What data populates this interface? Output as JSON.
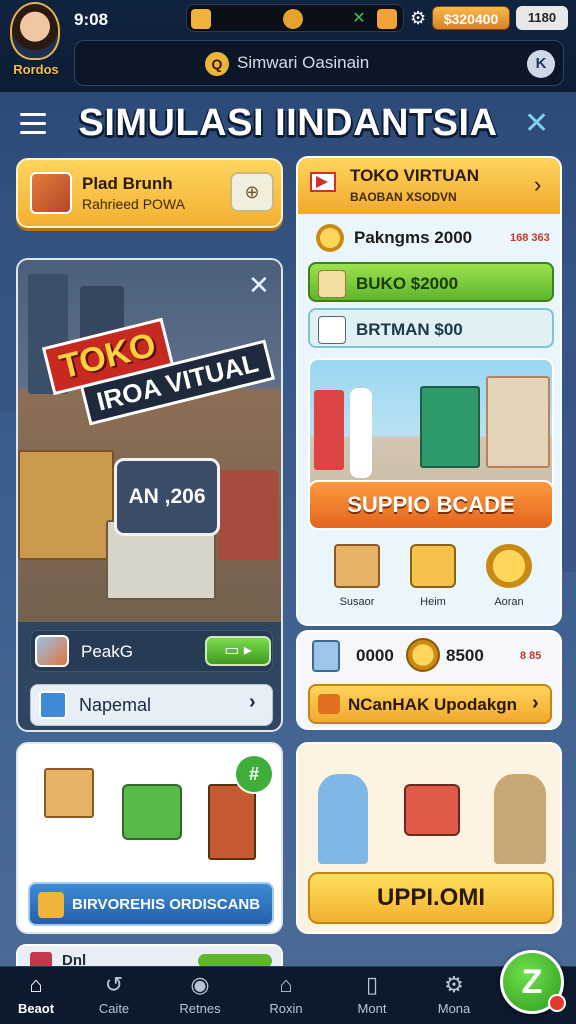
{
  "status": {
    "player_name": "Rordos",
    "time": "9:08",
    "money": "$320400",
    "level": "1180"
  },
  "search": {
    "placeholder": "Simwari Oasinain"
  },
  "header": {
    "title": "SIMULASI IINDANTSIA"
  },
  "plaid_card": {
    "line1": "Plad Brunh",
    "line2": "Rahrieed POWA"
  },
  "toko_card": {
    "title": "TOKO VIRTUAN",
    "subtitle": "BAOBAN XSODVN",
    "row1_label": "Pakngms 2000",
    "row1_value": "168 363",
    "row2_label": "BUKO $2000",
    "row3_label": "BRTMAN $00",
    "supply_button": "SUPPIO BCADE",
    "minis": [
      {
        "label": "Susaor"
      },
      {
        "label": "Heim"
      },
      {
        "label": "Aoran"
      }
    ]
  },
  "stat_card": {
    "v1": "0000",
    "v2": "8500",
    "v3": "8 85",
    "upgrade_label": "NCanHAK Upodakgn"
  },
  "game_card": {
    "sign1": "TOKO",
    "sign2": "IROA VITUAL",
    "badge": "AN ,206",
    "row1_label": "PeakG",
    "row2_label": "Napemal"
  },
  "bottom_left": {
    "button_label": "BIRVOREHIS ORDISCANB"
  },
  "bottom_right": {
    "button_label": "UPPI.OMI"
  },
  "peek_card": {
    "label": "Dnl"
  },
  "nav": {
    "items": [
      {
        "label": "Beaot",
        "icon": "home-icon"
      },
      {
        "label": "Caite",
        "icon": "undo-icon"
      },
      {
        "label": "Retnes",
        "icon": "coin-icon"
      },
      {
        "label": "Roxin",
        "icon": "house-icon"
      },
      {
        "label": "Mont",
        "icon": "book-icon"
      },
      {
        "label": "Mona",
        "icon": "gear-icon"
      }
    ],
    "fab": "Z"
  }
}
